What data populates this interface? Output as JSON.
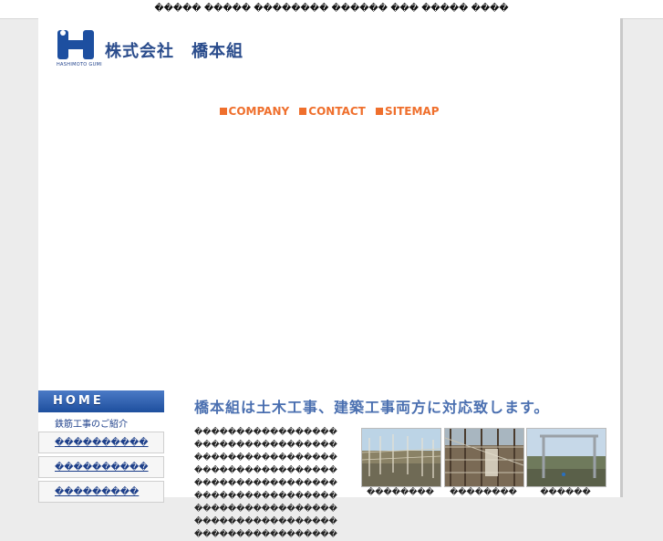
{
  "top_bar": {
    "text": "����� ����� �������� ������ ��� ����� ����"
  },
  "header": {
    "logo_sub": "HASHIMOTO GUMI",
    "company_name": "株式会社　橋本組"
  },
  "nav": {
    "items": [
      "COMPANY",
      "CONTACT",
      "SITEMAP"
    ]
  },
  "sidebar": {
    "home": "HOME",
    "intro": "鉄筋工事のご紹介",
    "items": [
      "����������",
      "����������",
      "���������"
    ]
  },
  "main": {
    "heading": "橋本組は土木工事、建築工事両方に対応致します。",
    "description": "���������������������������������������������������������������������������������������������������������������������������������������������������������",
    "photos": [
      {
        "caption": "��������"
      },
      {
        "caption": "��������"
      },
      {
        "caption": "������"
      }
    ]
  },
  "colors": {
    "accent": "#ef6f2c",
    "brand": "#1d4fa0",
    "heading": "#4a6fb0"
  }
}
